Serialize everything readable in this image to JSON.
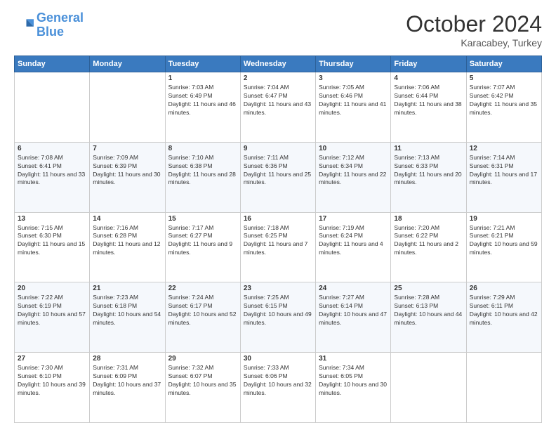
{
  "header": {
    "logo_line1": "General",
    "logo_line2": "Blue",
    "month": "October 2024",
    "location": "Karacabey, Turkey"
  },
  "weekdays": [
    "Sunday",
    "Monday",
    "Tuesday",
    "Wednesday",
    "Thursday",
    "Friday",
    "Saturday"
  ],
  "weeks": [
    [
      {
        "day": "",
        "info": ""
      },
      {
        "day": "",
        "info": ""
      },
      {
        "day": "1",
        "info": "Sunrise: 7:03 AM\nSunset: 6:49 PM\nDaylight: 11 hours and 46 minutes."
      },
      {
        "day": "2",
        "info": "Sunrise: 7:04 AM\nSunset: 6:47 PM\nDaylight: 11 hours and 43 minutes."
      },
      {
        "day": "3",
        "info": "Sunrise: 7:05 AM\nSunset: 6:46 PM\nDaylight: 11 hours and 41 minutes."
      },
      {
        "day": "4",
        "info": "Sunrise: 7:06 AM\nSunset: 6:44 PM\nDaylight: 11 hours and 38 minutes."
      },
      {
        "day": "5",
        "info": "Sunrise: 7:07 AM\nSunset: 6:42 PM\nDaylight: 11 hours and 35 minutes."
      }
    ],
    [
      {
        "day": "6",
        "info": "Sunrise: 7:08 AM\nSunset: 6:41 PM\nDaylight: 11 hours and 33 minutes."
      },
      {
        "day": "7",
        "info": "Sunrise: 7:09 AM\nSunset: 6:39 PM\nDaylight: 11 hours and 30 minutes."
      },
      {
        "day": "8",
        "info": "Sunrise: 7:10 AM\nSunset: 6:38 PM\nDaylight: 11 hours and 28 minutes."
      },
      {
        "day": "9",
        "info": "Sunrise: 7:11 AM\nSunset: 6:36 PM\nDaylight: 11 hours and 25 minutes."
      },
      {
        "day": "10",
        "info": "Sunrise: 7:12 AM\nSunset: 6:34 PM\nDaylight: 11 hours and 22 minutes."
      },
      {
        "day": "11",
        "info": "Sunrise: 7:13 AM\nSunset: 6:33 PM\nDaylight: 11 hours and 20 minutes."
      },
      {
        "day": "12",
        "info": "Sunrise: 7:14 AM\nSunset: 6:31 PM\nDaylight: 11 hours and 17 minutes."
      }
    ],
    [
      {
        "day": "13",
        "info": "Sunrise: 7:15 AM\nSunset: 6:30 PM\nDaylight: 11 hours and 15 minutes."
      },
      {
        "day": "14",
        "info": "Sunrise: 7:16 AM\nSunset: 6:28 PM\nDaylight: 11 hours and 12 minutes."
      },
      {
        "day": "15",
        "info": "Sunrise: 7:17 AM\nSunset: 6:27 PM\nDaylight: 11 hours and 9 minutes."
      },
      {
        "day": "16",
        "info": "Sunrise: 7:18 AM\nSunset: 6:25 PM\nDaylight: 11 hours and 7 minutes."
      },
      {
        "day": "17",
        "info": "Sunrise: 7:19 AM\nSunset: 6:24 PM\nDaylight: 11 hours and 4 minutes."
      },
      {
        "day": "18",
        "info": "Sunrise: 7:20 AM\nSunset: 6:22 PM\nDaylight: 11 hours and 2 minutes."
      },
      {
        "day": "19",
        "info": "Sunrise: 7:21 AM\nSunset: 6:21 PM\nDaylight: 10 hours and 59 minutes."
      }
    ],
    [
      {
        "day": "20",
        "info": "Sunrise: 7:22 AM\nSunset: 6:19 PM\nDaylight: 10 hours and 57 minutes."
      },
      {
        "day": "21",
        "info": "Sunrise: 7:23 AM\nSunset: 6:18 PM\nDaylight: 10 hours and 54 minutes."
      },
      {
        "day": "22",
        "info": "Sunrise: 7:24 AM\nSunset: 6:17 PM\nDaylight: 10 hours and 52 minutes."
      },
      {
        "day": "23",
        "info": "Sunrise: 7:25 AM\nSunset: 6:15 PM\nDaylight: 10 hours and 49 minutes."
      },
      {
        "day": "24",
        "info": "Sunrise: 7:27 AM\nSunset: 6:14 PM\nDaylight: 10 hours and 47 minutes."
      },
      {
        "day": "25",
        "info": "Sunrise: 7:28 AM\nSunset: 6:13 PM\nDaylight: 10 hours and 44 minutes."
      },
      {
        "day": "26",
        "info": "Sunrise: 7:29 AM\nSunset: 6:11 PM\nDaylight: 10 hours and 42 minutes."
      }
    ],
    [
      {
        "day": "27",
        "info": "Sunrise: 7:30 AM\nSunset: 6:10 PM\nDaylight: 10 hours and 39 minutes."
      },
      {
        "day": "28",
        "info": "Sunrise: 7:31 AM\nSunset: 6:09 PM\nDaylight: 10 hours and 37 minutes."
      },
      {
        "day": "29",
        "info": "Sunrise: 7:32 AM\nSunset: 6:07 PM\nDaylight: 10 hours and 35 minutes."
      },
      {
        "day": "30",
        "info": "Sunrise: 7:33 AM\nSunset: 6:06 PM\nDaylight: 10 hours and 32 minutes."
      },
      {
        "day": "31",
        "info": "Sunrise: 7:34 AM\nSunset: 6:05 PM\nDaylight: 10 hours and 30 minutes."
      },
      {
        "day": "",
        "info": ""
      },
      {
        "day": "",
        "info": ""
      }
    ]
  ]
}
